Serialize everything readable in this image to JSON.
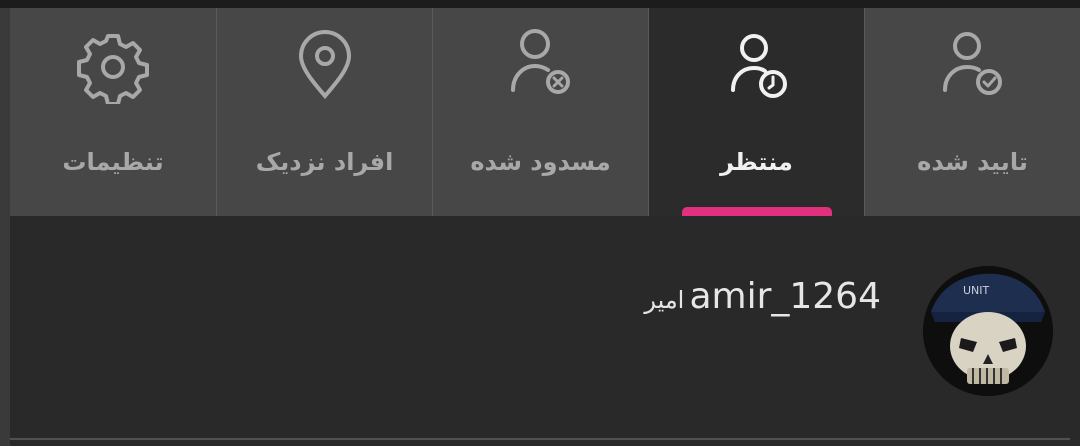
{
  "tabs": [
    {
      "label": "تنظیمات",
      "icon": "gear-icon",
      "active": false
    },
    {
      "label": "افراد نزدیک",
      "icon": "location-pin-icon",
      "active": false
    },
    {
      "label": "مسدود شده",
      "icon": "user-blocked-icon",
      "active": false
    },
    {
      "label": "منتظر",
      "icon": "user-pending-icon",
      "active": true
    },
    {
      "label": "تایید شده",
      "icon": "user-approved-icon",
      "active": false
    }
  ],
  "colors": {
    "accent": "#e0307e",
    "active_tab_bg": "#2b2b2b",
    "tab_bg": "#474747",
    "page_bg": "#292929"
  },
  "list": [
    {
      "display_name": "امیر",
      "username": "amir_1264",
      "avatar": "skull-avatar"
    }
  ]
}
